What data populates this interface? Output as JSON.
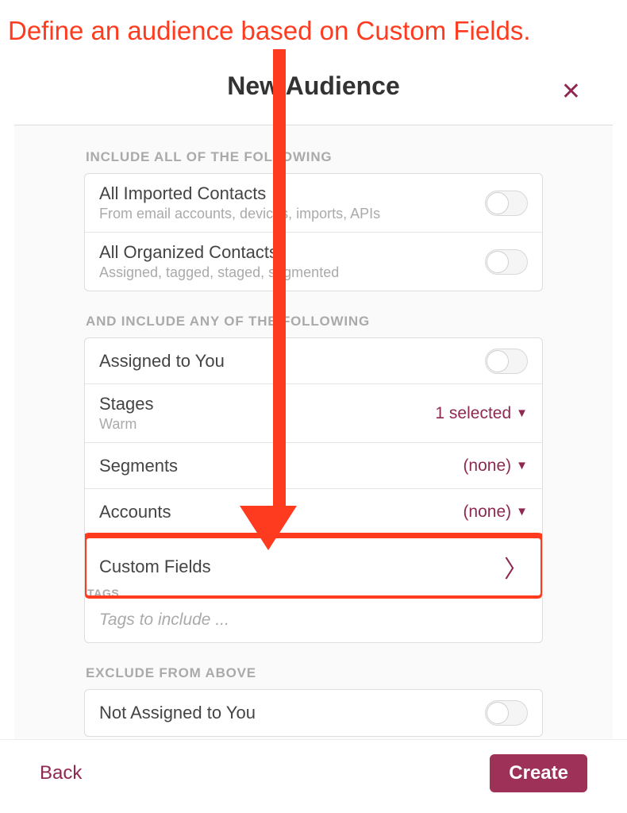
{
  "annotation": "Define an audience based on Custom Fields.",
  "header": {
    "title": "New Audience"
  },
  "sections": {
    "include_all": {
      "label": "Include all of the Following",
      "rows": [
        {
          "title": "All Imported Contacts",
          "subtitle": "From email accounts, devices, imports, APIs"
        },
        {
          "title": "All Organized Contacts",
          "subtitle": "Assigned, tagged, staged, segmented"
        }
      ]
    },
    "include_any": {
      "label": "And include any of the following",
      "assigned": {
        "title": "Assigned to You"
      },
      "stages": {
        "title": "Stages",
        "subtitle": "Warm",
        "value": "1 selected"
      },
      "segments": {
        "title": "Segments",
        "value": "(none)"
      },
      "accounts": {
        "title": "Accounts",
        "value": "(none)"
      },
      "custom_fields": {
        "title": "Custom Fields"
      }
    },
    "tags": {
      "label": "Tags",
      "placeholder": "Tags to include ..."
    },
    "exclude": {
      "label": "Exclude From Above",
      "not_assigned": {
        "title": "Not Assigned to You"
      }
    }
  },
  "footer": {
    "back": "Back",
    "create": "Create"
  }
}
